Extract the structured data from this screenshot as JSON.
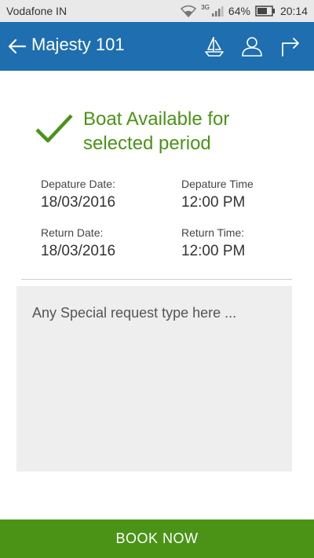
{
  "status_bar": {
    "carrier": "Vodafone IN",
    "network": "3G",
    "battery": "64%",
    "time": "20:14"
  },
  "header": {
    "title": "Majesty 101"
  },
  "availability": {
    "message": "Boat Available for selected period"
  },
  "details": {
    "departure_date_label": "Depature  Date:",
    "departure_date": "18/03/2016",
    "departure_time_label": "Depature  Time",
    "departure_time": "12:00 PM",
    "return_date_label": "Return Date:",
    "return_date": "18/03/2016",
    "return_time_label": "Return Time:",
    "return_time": "12:00 PM"
  },
  "request": {
    "placeholder": "Any Special request type here ..."
  },
  "book_button": {
    "label": "BOOK NOW"
  },
  "colors": {
    "app_bar": "#1e6eb0",
    "accent_green": "#4a9317"
  },
  "icons": [
    "back-arrow-icon",
    "sailboat-icon",
    "user-icon",
    "share-icon",
    "checkmark-icon"
  ]
}
